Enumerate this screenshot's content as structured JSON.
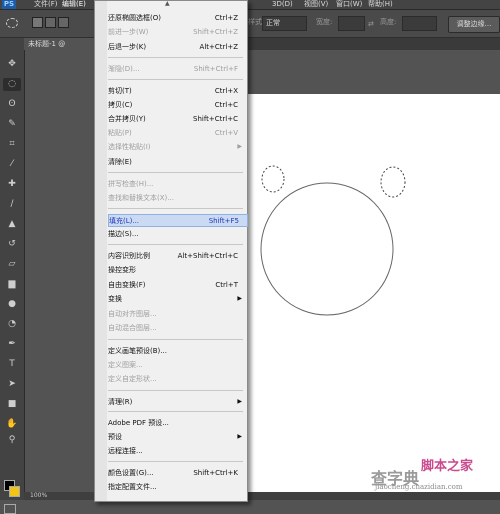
{
  "app": {
    "logo": "PS"
  },
  "menubar": [
    {
      "label": "文件(F)"
    },
    {
      "label": "编辑(E)"
    },
    {
      "label": "3D(D)"
    },
    {
      "label": "视图(V)"
    },
    {
      "label": "窗口(W)"
    },
    {
      "label": "帮助(H)"
    }
  ],
  "options_bar": {
    "style_label": "样式:",
    "style_value": "正常",
    "width_label": "宽度:",
    "height_label": "高度:",
    "refine_edge": "调整边缘..."
  },
  "document": {
    "tab_label": "未标题-1 @"
  },
  "status": {
    "zoom": "100%"
  },
  "colors": {
    "foreground": "#000000",
    "background": "#f2c417",
    "highlight_text": "#2438b8"
  },
  "tools": [
    "move-icon",
    "marquee-icon",
    "lasso-icon",
    "quick-select-icon",
    "crop-icon",
    "eyedropper-icon",
    "heal-icon",
    "brush-icon",
    "stamp-icon",
    "history-brush-icon",
    "eraser-icon",
    "gradient-icon",
    "blur-icon",
    "dodge-icon",
    "pen-icon",
    "type-icon",
    "path-select-icon",
    "shape-icon",
    "hand-icon",
    "zoom-icon"
  ],
  "edit_menu": {
    "items": [
      {
        "label": "还原椭圆选框(O)",
        "shortcut": "Ctrl+Z",
        "state": "enabled"
      },
      {
        "label": "前进一步(W)",
        "shortcut": "Shift+Ctrl+Z",
        "state": "disabled"
      },
      {
        "label": "后退一步(K)",
        "shortcut": "Alt+Ctrl+Z",
        "state": "enabled"
      },
      {
        "label": "渐隐(D)...",
        "shortcut": "Shift+Ctrl+F",
        "state": "disabled"
      },
      {
        "label": "剪切(T)",
        "shortcut": "Ctrl+X",
        "state": "enabled"
      },
      {
        "label": "拷贝(C)",
        "shortcut": "Ctrl+C",
        "state": "enabled"
      },
      {
        "label": "合并拷贝(Y)",
        "shortcut": "Shift+Ctrl+C",
        "state": "enabled"
      },
      {
        "label": "粘贴(P)",
        "shortcut": "Ctrl+V",
        "state": "disabled"
      },
      {
        "label": "选择性粘贴(I)",
        "shortcut": "",
        "state": "disabled",
        "submenu": true
      },
      {
        "label": "清除(E)",
        "shortcut": "",
        "state": "enabled"
      },
      {
        "label": "拼写检查(H)...",
        "shortcut": "",
        "state": "disabled"
      },
      {
        "label": "查找和替换文本(X)...",
        "shortcut": "",
        "state": "disabled"
      },
      {
        "label": "填充(L)...",
        "shortcut": "Shift+F5",
        "state": "highlighted"
      },
      {
        "label": "描边(S)...",
        "shortcut": "",
        "state": "enabled"
      },
      {
        "label": "内容识别比例",
        "shortcut": "Alt+Shift+Ctrl+C",
        "state": "enabled"
      },
      {
        "label": "操控变形",
        "shortcut": "",
        "state": "enabled"
      },
      {
        "label": "自由变换(F)",
        "shortcut": "Ctrl+T",
        "state": "enabled"
      },
      {
        "label": "变换",
        "shortcut": "",
        "state": "enabled",
        "submenu": true
      },
      {
        "label": "自动对齐图层...",
        "shortcut": "",
        "state": "disabled"
      },
      {
        "label": "自动混合图层...",
        "shortcut": "",
        "state": "disabled"
      },
      {
        "label": "定义画笔预设(B)...",
        "shortcut": "",
        "state": "enabled"
      },
      {
        "label": "定义图案...",
        "shortcut": "",
        "state": "disabled"
      },
      {
        "label": "定义自定形状...",
        "shortcut": "",
        "state": "disabled"
      },
      {
        "label": "清理(R)",
        "shortcut": "",
        "state": "enabled",
        "submenu": true
      },
      {
        "label": "Adobe PDF 预设...",
        "shortcut": "",
        "state": "enabled"
      },
      {
        "label": "预设",
        "shortcut": "",
        "state": "enabled",
        "submenu": true
      },
      {
        "label": "远程连接...",
        "shortcut": "",
        "state": "enabled"
      },
      {
        "label": "颜色设置(G)...",
        "shortcut": "Shift+Ctrl+K",
        "state": "enabled"
      },
      {
        "label": "指定配置文件...",
        "shortcut": "",
        "state": "enabled"
      }
    ]
  },
  "watermark": {
    "line1": "查字典",
    "line2": "脚本之家",
    "line3": "jiaocheng.chazidian.com"
  }
}
